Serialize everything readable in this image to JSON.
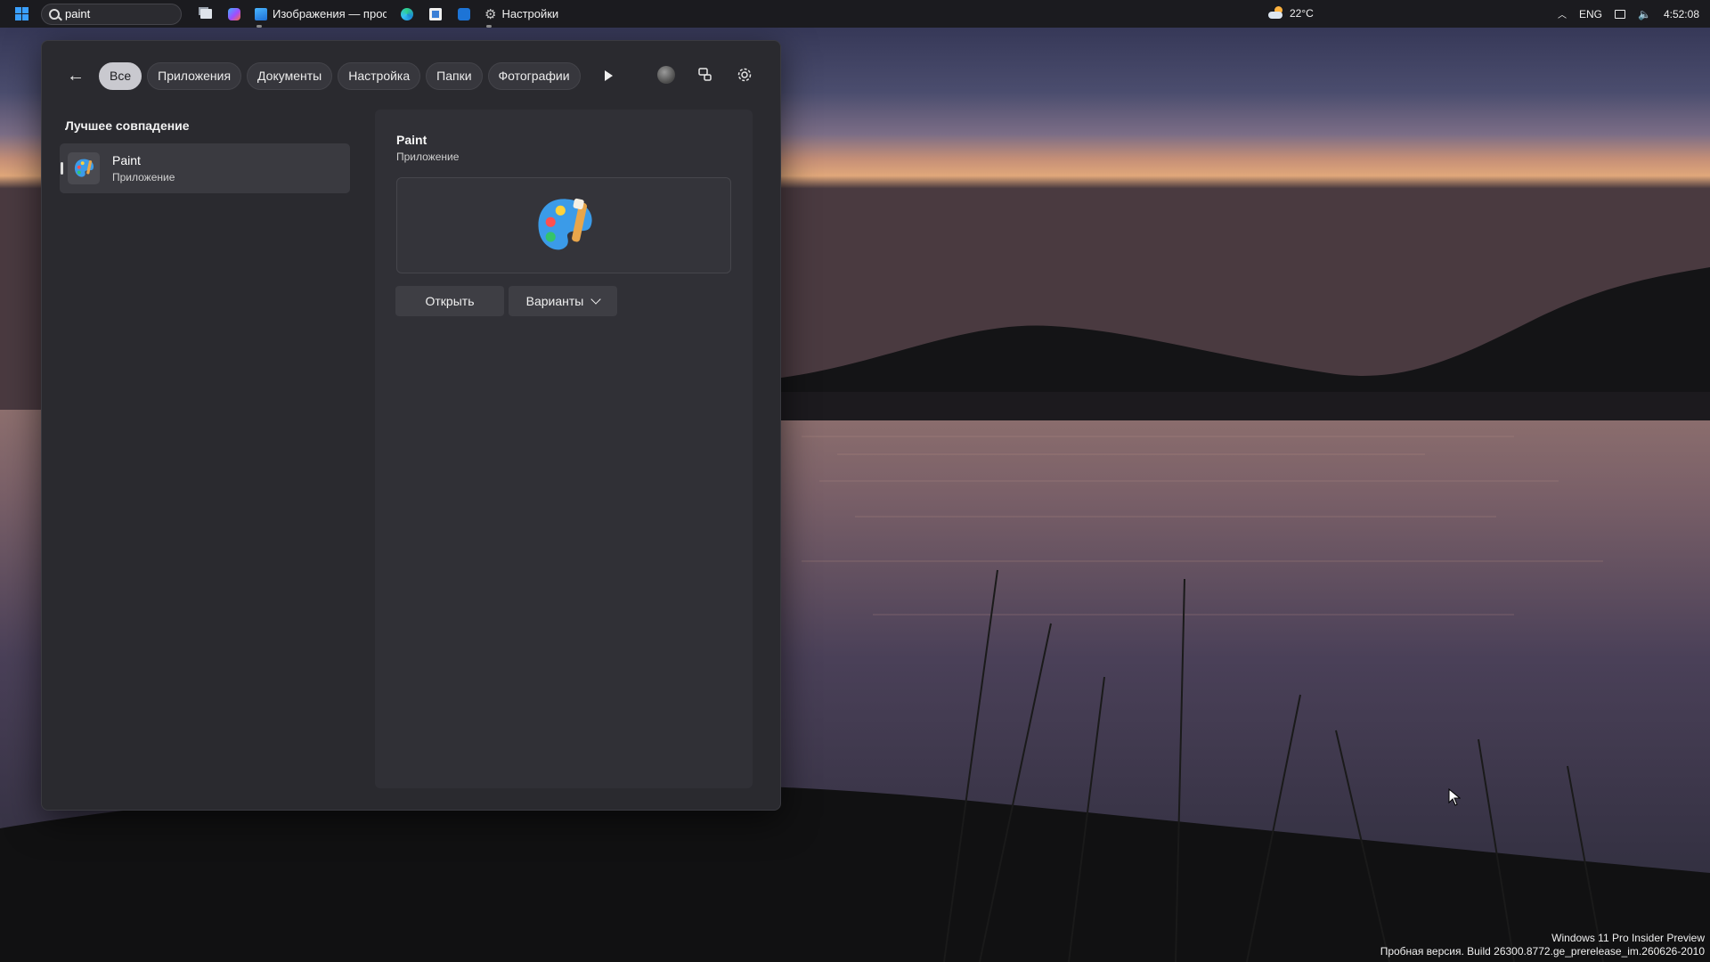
{
  "taskbar": {
    "search_value": "paint",
    "apps": [
      {
        "name": "task-view",
        "icon": "task-view-icon"
      },
      {
        "name": "copilot",
        "icon": "copilot-icon"
      },
      {
        "name": "photos",
        "icon": "photos-icon",
        "title": "Изображения — просм"
      },
      {
        "name": "edge",
        "icon": "edge-icon"
      },
      {
        "name": "store",
        "icon": "store-icon"
      },
      {
        "name": "outlook",
        "icon": "outlook-icon"
      },
      {
        "name": "settings",
        "icon": "gear-icon",
        "title": "Настройки"
      }
    ],
    "weather": "22°C",
    "language": "ENG",
    "time": "4:52:08"
  },
  "search_panel": {
    "filters": [
      "Все",
      "Приложения",
      "Документы",
      "Настройка",
      "Папки",
      "Фотографии"
    ],
    "active_filter": "Все",
    "best_match_title": "Лучшее совпадение",
    "best_match": {
      "name": "Paint",
      "type": "Приложение"
    },
    "detail": {
      "name": "Paint",
      "type": "Приложение",
      "open_label": "Открыть",
      "variants_label": "Варианты"
    }
  },
  "watermark": {
    "line1": "Windows 11 Pro Insider Preview",
    "line2": "Пробная версия. Build 26300.8772.ge_prerelease_im.260626-2010"
  }
}
